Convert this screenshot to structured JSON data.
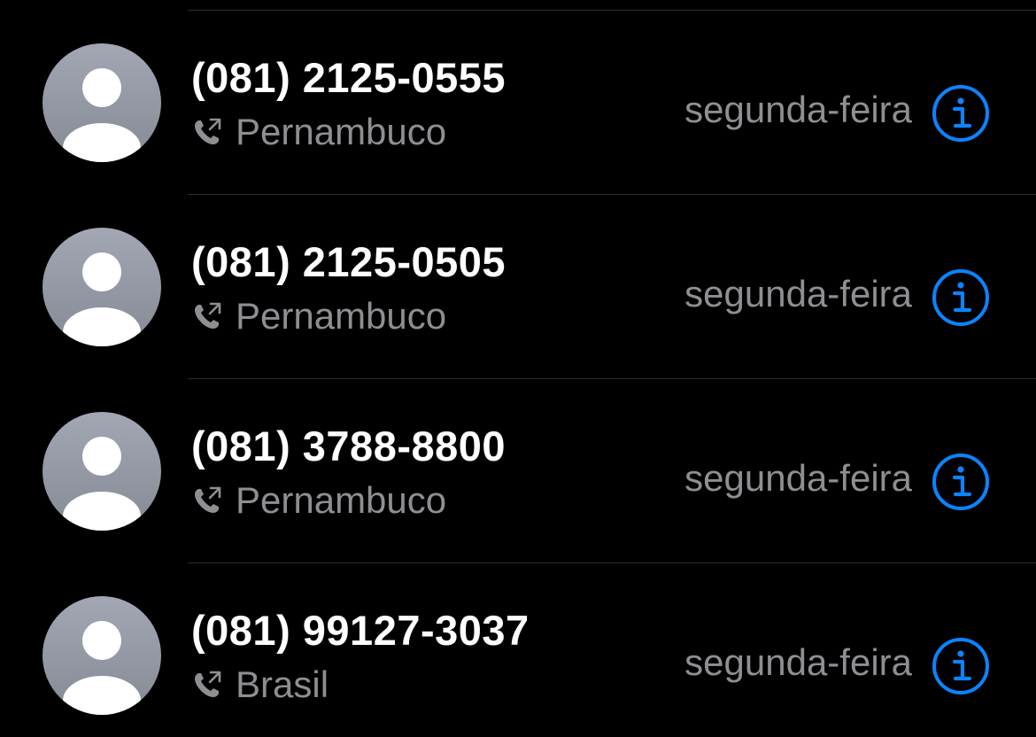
{
  "colors": {
    "background": "#000000",
    "primary_text": "#ffffff",
    "secondary_text": "#8e8e93",
    "accent": "#0a84ff",
    "divider": "#2c2c2e"
  },
  "icons": {
    "avatar": "person-avatar-icon",
    "call_type": "outgoing-call-icon",
    "info": "info-circle-icon"
  },
  "calls": [
    {
      "number": "(081) 2125-0555",
      "location": "Pernambuco",
      "date": "segunda-feira"
    },
    {
      "number": "(081) 2125-0505",
      "location": "Pernambuco",
      "date": "segunda-feira"
    },
    {
      "number": "(081) 3788-8800",
      "location": "Pernambuco",
      "date": "segunda-feira"
    },
    {
      "number": "(081) 99127-3037",
      "location": "Brasil",
      "date": "segunda-feira"
    }
  ]
}
